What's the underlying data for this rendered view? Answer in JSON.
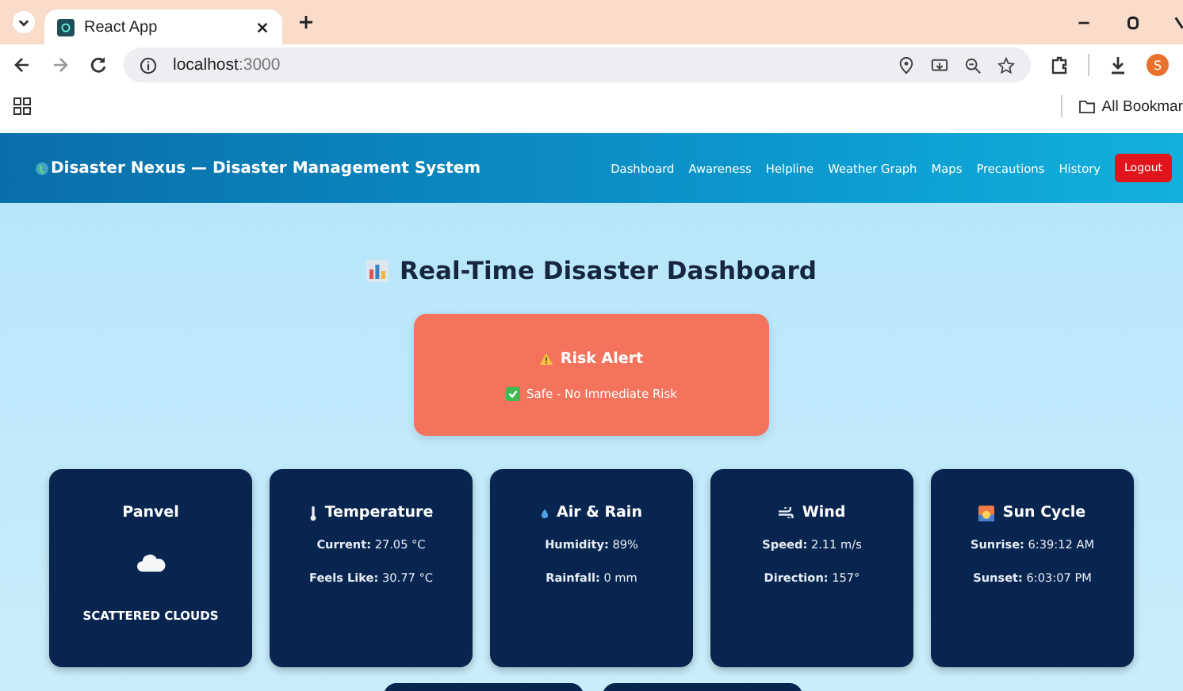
{
  "browser": {
    "tab_title": "React App",
    "url_host": "localhost",
    "url_port": ":3000",
    "profile_initial": "S",
    "bookmarks_folder": "All Bookmar"
  },
  "nav": {
    "brand": "Disaster Nexus — Disaster Management System",
    "links": [
      {
        "label": "Dashboard"
      },
      {
        "label": "Awareness"
      },
      {
        "label": "Helpline"
      },
      {
        "label": "Weather Graph"
      },
      {
        "label": "Maps"
      },
      {
        "label": "Precautions"
      },
      {
        "label": "History"
      }
    ],
    "logout": "Logout"
  },
  "heading": "Real-Time Disaster Dashboard",
  "alert": {
    "title": "Risk Alert",
    "message": "Safe - No Immediate Risk"
  },
  "cards": [
    {
      "kind": "location",
      "title": "Panvel",
      "condition": "SCATTERED CLOUDS"
    },
    {
      "kind": "temperature",
      "title": "Temperature",
      "lines": [
        "**Current:** 27.05 °C",
        "**Feels Like:** 30.77 °C"
      ]
    },
    {
      "kind": "rain",
      "title": "Air & Rain",
      "lines": [
        "**Humidity:** 89%",
        "**Rainfall:** 0 mm"
      ]
    },
    {
      "kind": "wind",
      "title": "Wind",
      "lines": [
        "**Speed:** 2.11 m/s",
        "**Direction:** 157°"
      ]
    },
    {
      "kind": "sun",
      "title": "Sun Cycle",
      "lines": [
        "**Sunrise:** 6:39:12 AM",
        "**Sunset:** 6:03:07 PM"
      ]
    }
  ]
}
